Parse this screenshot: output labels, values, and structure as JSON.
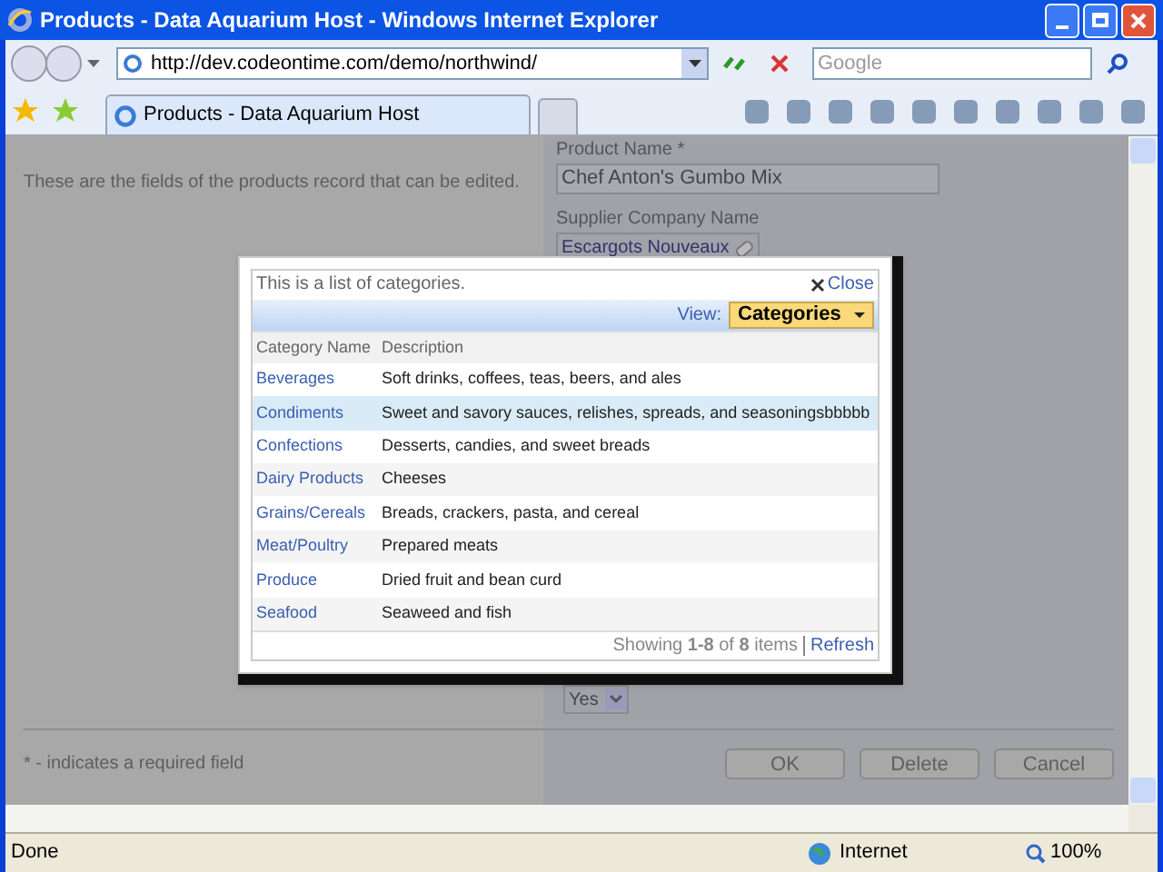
{
  "window": {
    "title": "Products - Data Aquarium Host - Windows Internet Explorer"
  },
  "address_bar": {
    "url": "http://dev.codeontime.com/demo/northwind/",
    "search_placeholder": "Google"
  },
  "tabs": [
    {
      "label": "Products - Data Aquarium Host",
      "selected": true
    }
  ],
  "page": {
    "description": "These are the fields of the products record that can be edited.",
    "fields": [
      {
        "kind": "text",
        "label": "Product Name *",
        "value": "Chef Anton's Gumbo Mix"
      },
      {
        "kind": "lookup",
        "label": "Supplier Company Name",
        "value": "Escargots Nouveaux"
      },
      {
        "kind": "select",
        "value": "Yes"
      }
    ],
    "note": "* - indicates a required field",
    "buttons": [
      "OK",
      "Delete",
      "Cancel"
    ]
  },
  "modal": {
    "description": "This is a list of categories.",
    "close": "Close",
    "view_label": "View:",
    "view": "Categories",
    "columns": [
      "Category Name",
      "Description"
    ],
    "rows": [
      {
        "name": "Beverages",
        "description": "Soft drinks, coffees, teas, beers, and ales",
        "selected": false
      },
      {
        "name": "Condiments",
        "description": "Sweet and savory sauces, relishes, spreads, and seasoningsbbbbb",
        "selected": true
      },
      {
        "name": "Confections",
        "description": "Desserts, candies, and sweet breads",
        "selected": false
      },
      {
        "name": "Dairy Products",
        "description": "Cheeses",
        "selected": false
      },
      {
        "name": "Grains/Cereals",
        "description": "Breads, crackers, pasta, and cereal",
        "selected": false
      },
      {
        "name": "Meat/Poultry",
        "description": "Prepared meats",
        "selected": false
      },
      {
        "name": "Produce",
        "description": "Dried fruit and bean curd",
        "selected": false
      },
      {
        "name": "Seafood",
        "description": "Seaweed and fish",
        "selected": false
      }
    ],
    "pager": "Showing **1-8** of **8** items",
    "refresh": "Refresh"
  },
  "status_bar": {
    "text": "Done",
    "zone": "Internet",
    "zoom": "100%"
  }
}
